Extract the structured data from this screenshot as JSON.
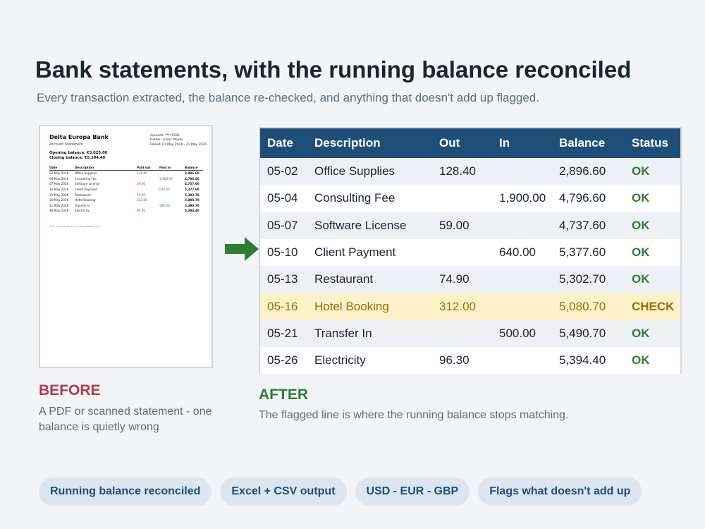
{
  "header": {
    "title": "Bank statements, with the running balance reconciled",
    "subtitle": "Every transaction extracted, the balance re-checked, and anything that doesn't add up flagged."
  },
  "statement": {
    "bank": "Delta Europa Bank",
    "doc_title": "Account Statement",
    "account": "Account: ****1290",
    "holder": "Holder: Lukas Meyer",
    "period": "Period: 01 May 2026 - 31 May 2026",
    "opening": "Opening balance: €3,025.00",
    "closing": "Closing balance: €5,394.40",
    "columns": [
      "Date",
      "Description",
      "Paid out",
      "Paid in",
      "Balance"
    ],
    "rows": [
      {
        "date": "02 May 2026",
        "desc": "Office Supplies",
        "out": "128.40",
        "in": "",
        "bal": "2,896.60"
      },
      {
        "date": "04 May 2026",
        "desc": "Consulting Fee",
        "out": "",
        "in": "1,900.00",
        "bal": "4,796.60"
      },
      {
        "date": "07 May 2026",
        "desc": "Software License",
        "out": "59.00",
        "in": "",
        "bal": "4,737.60"
      },
      {
        "date": "10 May 2026",
        "desc": "Client Payment",
        "out": "",
        "in": "640.00",
        "bal": "5,377.60"
      },
      {
        "date": "13 May 2026",
        "desc": "Restaurant",
        "out": "74.90",
        "in": "",
        "bal": "5,302.70"
      },
      {
        "date": "16 May 2026",
        "desc": "Hotel Booking",
        "out": "312.00",
        "in": "",
        "bal": "5,080.70"
      },
      {
        "date": "21 May 2026",
        "desc": "Transfer In",
        "out": "",
        "in": "500.00",
        "bal": "5,490.70"
      },
      {
        "date": "26 May 2026",
        "desc": "Electricity",
        "out": "96.30",
        "in": "",
        "bal": "5,394.40"
      }
    ],
    "footer": "This statement is for information only."
  },
  "before": {
    "label": "BEFORE",
    "caption": "A PDF or scanned statement - one balance is quietly wrong"
  },
  "arrow_icon": "arrow-right-icon",
  "table": {
    "columns": [
      "Date",
      "Description",
      "Out",
      "In",
      "Balance",
      "Status"
    ],
    "rows": [
      {
        "date": "05-02",
        "desc": "Office Supplies",
        "out": "128.40",
        "in": "",
        "bal": "2,896.60",
        "status": "OK",
        "flag": false
      },
      {
        "date": "05-04",
        "desc": "Consulting Fee",
        "out": "",
        "in": "1,900.00",
        "bal": "4,796.60",
        "status": "OK",
        "flag": false
      },
      {
        "date": "05-07",
        "desc": "Software License",
        "out": "59.00",
        "in": "",
        "bal": "4,737.60",
        "status": "OK",
        "flag": false
      },
      {
        "date": "05-10",
        "desc": "Client Payment",
        "out": "",
        "in": "640.00",
        "bal": "5,377.60",
        "status": "OK",
        "flag": false
      },
      {
        "date": "05-13",
        "desc": "Restaurant",
        "out": "74.90",
        "in": "",
        "bal": "5,302.70",
        "status": "OK",
        "flag": false
      },
      {
        "date": "05-16",
        "desc": "Hotel Booking",
        "out": "312.00",
        "in": "",
        "bal": "5,080.70",
        "status": "CHECK",
        "flag": true
      },
      {
        "date": "05-21",
        "desc": "Transfer In",
        "out": "",
        "in": "500.00",
        "bal": "5,490.70",
        "status": "OK",
        "flag": false
      },
      {
        "date": "05-26",
        "desc": "Electricity",
        "out": "96.30",
        "in": "",
        "bal": "5,394.40",
        "status": "OK",
        "flag": false
      }
    ]
  },
  "after": {
    "label": "AFTER",
    "caption": "The flagged line is where the running balance stops matching."
  },
  "pills": [
    "Running balance reconciled",
    "Excel + CSV output",
    "USD - EUR - GBP",
    "Flags what doesn't add up"
  ],
  "colors": {
    "header_bg": "#1f4e79",
    "ok": "#2e7d32",
    "check": "#9c6b00",
    "flag_row": "#fdf2c9",
    "before": "#b23a48"
  }
}
